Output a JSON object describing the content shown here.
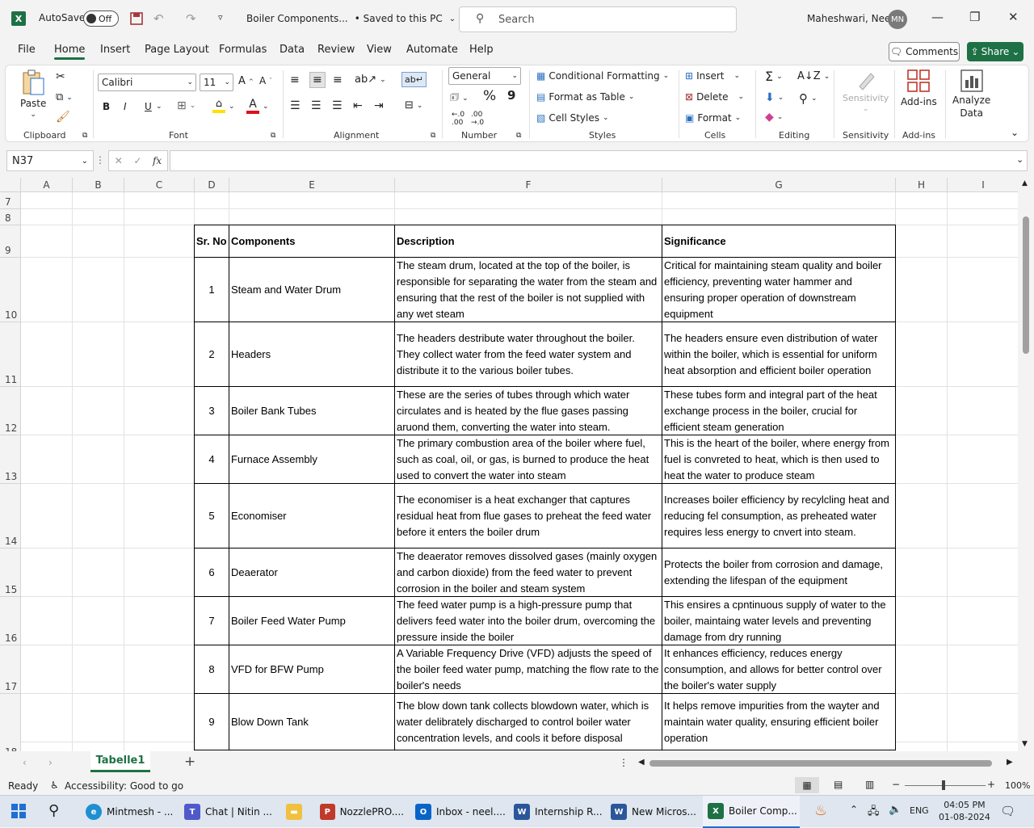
{
  "titlebar": {
    "autosave_label": "AutoSave",
    "autosave_state": "Off",
    "doc_title": "Boiler Components...",
    "save_status": "• Saved to this PC",
    "search_placeholder": "Search",
    "user_name": "Maheshwari, Neel",
    "user_initials": "MN"
  },
  "menu": {
    "tabs": [
      "File",
      "Home",
      "Insert",
      "Page Layout",
      "Formulas",
      "Data",
      "Review",
      "View",
      "Automate",
      "Help"
    ],
    "comments_label": "Comments",
    "share_label": "Share"
  },
  "ribbon": {
    "clipboard": {
      "paste": "Paste",
      "label": "Clipboard"
    },
    "font": {
      "name": "Calibri",
      "size": "11",
      "label": "Font",
      "bold": "B",
      "italic": "I",
      "underline": "U"
    },
    "alignment": {
      "label": "Alignment"
    },
    "number": {
      "format": "General",
      "label": "Number",
      "percent": "%",
      "comma": "9"
    },
    "styles": {
      "cond_format": "Conditional Formatting",
      "format_table": "Format as Table",
      "cell_styles": "Cell Styles",
      "label": "Styles"
    },
    "cells": {
      "insert": "Insert",
      "delete": "Delete",
      "format": "Format",
      "label": "Cells"
    },
    "editing": {
      "label": "Editing"
    },
    "sensitivity": {
      "button": "Sensitivity",
      "label": "Sensitivity"
    },
    "addins": {
      "button": "Add-ins",
      "label": "Add-ins"
    },
    "analyze": {
      "line1": "Analyze",
      "line2": "Data"
    }
  },
  "formula_bar": {
    "name_box": "N37",
    "fx": "fx",
    "content": ""
  },
  "columns": [
    "A",
    "B",
    "C",
    "D",
    "E",
    "F",
    "G",
    "H",
    "I"
  ],
  "rows": [
    "7",
    "8",
    "9",
    "10",
    "11",
    "12",
    "13",
    "14",
    "15",
    "16",
    "17",
    "18"
  ],
  "table": {
    "headers": [
      "Sr. No",
      "Components",
      "Description",
      "Significance"
    ],
    "rows": [
      {
        "sr": "1",
        "component": "Steam and Water Drum",
        "description": "The steam drum, located at the top of the boiler, is responsible for separating the water from the steam and ensuring that the rest of the boiler is not supplied with any wet steam",
        "significance": "Critical for maintaining steam quality and boiler efficiency, preventing water hammer and ensuring proper operation of downstream equipment"
      },
      {
        "sr": "2",
        "component": "Headers",
        "description": "The headers destribute water throughout the boiler. They collect water from the feed water system and distribute it to the various boiler tubes.",
        "significance": "The headers ensure even distribution of water within the boiler, which is essential for uniform heat absorption and efficient boiler operation"
      },
      {
        "sr": "3",
        "component": "Boiler Bank Tubes",
        "description": "These are the series of tubes through which water circulates and is heated by the flue gases passing aruond them, converting the water into steam.",
        "significance": "These tubes form and integral part of the heat exchange process in the boiler, crucial for efficient steam generation"
      },
      {
        "sr": "4",
        "component": "Furnace Assembly",
        "description": "The primary combustion area of the boiler where fuel, such as coal, oil, or gas, is burned to produce the heat used to convert the water into steam",
        "significance": "This is the heart of the boiler, where energy from fuel is convreted to heat, which is then used to heat the water to produce steam"
      },
      {
        "sr": "5",
        "component": "Economiser",
        "description": "The economiser is a heat exchanger that captures residual heat from flue gases to preheat the feed water before it enters the boiler drum",
        "significance": "Increases boiler efficiency by recylcling heat and reducing fel consumption, as preheated water requires less energy to cnvert into steam."
      },
      {
        "sr": "6",
        "component": "Deaerator",
        "description": "The deaerator removes dissolved gases (mainly oxygen and carbon dioxide) from the feed water to prevent corrosion in the boiler and steam system",
        "significance": "Protects the boiler from corrosion and damage, extending the lifespan of the equipment"
      },
      {
        "sr": "7",
        "component": "Boiler Feed Water Pump",
        "description": "The feed water pump is a high-pressure pump that delivers feed water into the boiler drum, overcoming the pressure inside the boiler",
        "significance": "This ensires a cpntinuous supply of water to the boiler, maintaing water levels and preventing damage from dry running"
      },
      {
        "sr": "8",
        "component": "VFD for BFW Pump",
        "description": "A Variable Frequency Drive (VFD) adjusts the speed of the boiler feed water pump, matching the flow rate to the boiler's needs",
        "significance": "It enhances efficiency, reduces energy consumption, and allows for better control over the boiler's water supply"
      },
      {
        "sr": "9",
        "component": "Blow Down Tank",
        "description": "The blow down tank collects blowdown water, which is water delibrately discharged to control boiler water concentration levels, and cools it before disposal",
        "significance": "It helps remove impurities from the wayter and maintain water quality, ensuring efficient boiler operation"
      }
    ]
  },
  "sheets": {
    "active": "Tabelle1"
  },
  "status": {
    "ready": "Ready",
    "accessibility": "Accessibility: Good to go",
    "zoom": "100%"
  },
  "taskbar": {
    "apps": [
      "Mintmesh - ...",
      "Chat | Nitin ...",
      "NozzlePRO....",
      "Inbox - neel....",
      "Internship R...",
      "New Micros...",
      "Boiler Comp..."
    ],
    "lang": "ENG",
    "time": "04:05 PM",
    "date": "01-08-2024"
  },
  "colors": {
    "excel_green": "#1e7145",
    "accent_blue": "#1f6fd0"
  }
}
